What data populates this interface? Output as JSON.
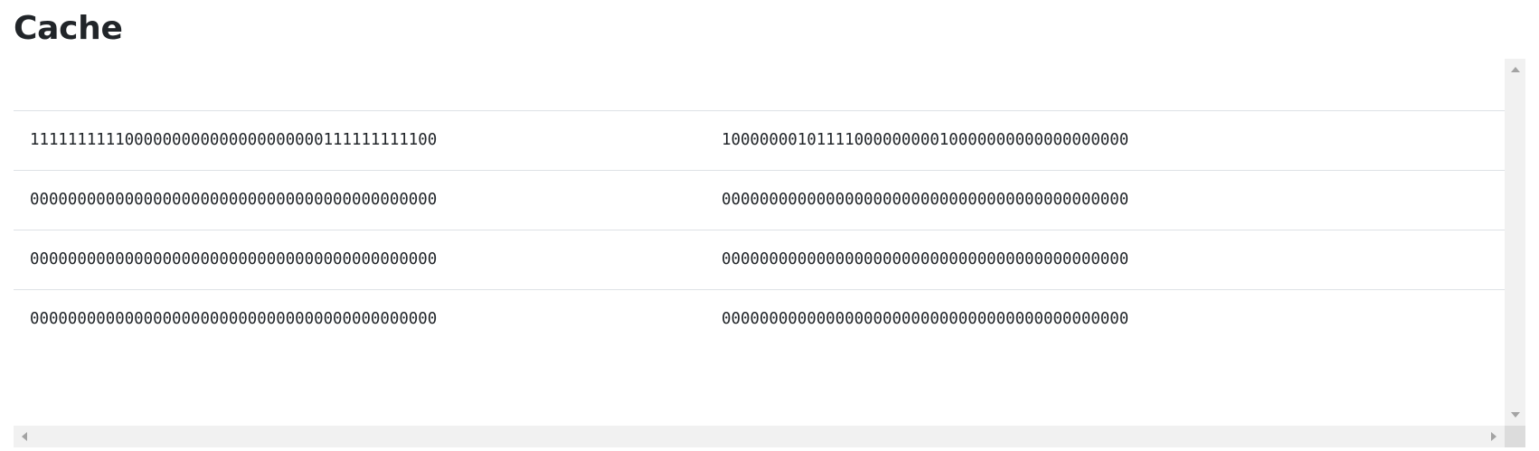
{
  "page": {
    "title": "Cache"
  },
  "cache_table": {
    "rows": [
      {
        "col1": "1111111111000000000000000000000111111111100",
        "col2": "1000000010111100000000010000000000000000000"
      },
      {
        "col1": "0000000000000000000000000000000000000000000",
        "col2": "0000000000000000000000000000000000000000000"
      },
      {
        "col1": "0000000000000000000000000000000000000000000",
        "col2": "0000000000000000000000000000000000000000000"
      },
      {
        "col1": "0000000000000000000000000000000000000000000",
        "col2": "0000000000000000000000000000000000000000000"
      }
    ]
  },
  "colors": {
    "text": "#212529",
    "row_border": "#dee2e6",
    "scrollbar_track": "#f1f1f1",
    "scrollbar_arrow": "#a3a3a3"
  }
}
